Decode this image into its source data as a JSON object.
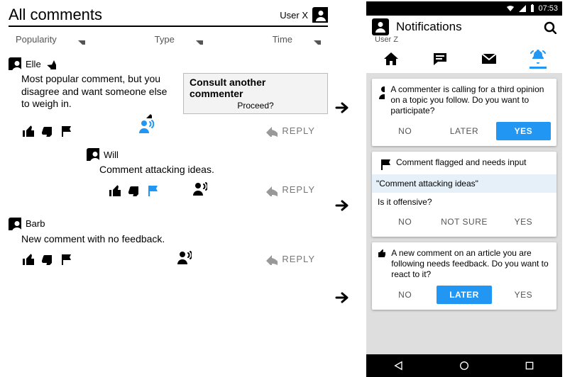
{
  "left": {
    "title": "All comments",
    "current_user": "User X",
    "filters": [
      "Popularity",
      "Type",
      "Time"
    ],
    "reply_label": "REPLY",
    "comments": [
      {
        "author": "Elle",
        "starred": true,
        "body": "Most popular comment, but you disagree and want someone else to weigh in.",
        "tooltip_title": "Consult another commenter",
        "tooltip_proceed": "Proceed?"
      },
      {
        "author": "Will",
        "nested": true,
        "body": "Comment attacking ideas."
      },
      {
        "author": "Barb",
        "body": "New comment with no feedback."
      }
    ]
  },
  "phone": {
    "time": "07:53",
    "title": "Notifications",
    "user": "User Z",
    "notifications": [
      {
        "text": "A commenter is calling for a third opinion on a topic you follow. Do you want to participate?",
        "actions": [
          "NO",
          "LATER",
          "YES"
        ],
        "primary": "YES"
      },
      {
        "heading": "Comment flagged and needs input",
        "quote": "\"Comment attacking ideas\"",
        "question": "Is it offensive?",
        "actions": [
          "NO",
          "NOT SURE",
          "YES"
        ]
      },
      {
        "text": "A new comment on an article you are following needs feedback. Do you want to react to it?",
        "actions": [
          "NO",
          "LATER",
          "YES"
        ],
        "primary": "LATER"
      }
    ]
  }
}
